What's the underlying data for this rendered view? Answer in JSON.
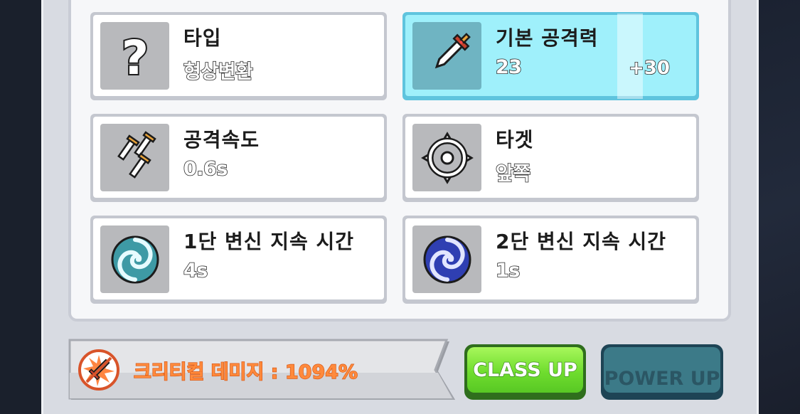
{
  "stats": [
    {
      "label": "타입",
      "value": "형상변환",
      "icon": "question-mark-icon"
    },
    {
      "label": "기본 공격력",
      "value": "23",
      "bonus": "+30",
      "icon": "sword-icon",
      "highlighted": true
    },
    {
      "label": "공격속도",
      "value": "0.6s",
      "icon": "triple-sword-icon"
    },
    {
      "label": "타겟",
      "value": "앞쪽",
      "icon": "crosshair-icon"
    },
    {
      "label": "1단 변신 지속 시간",
      "value": "4s",
      "icon": "teal-swirl-icon"
    },
    {
      "label": "2단 변신 지속 시간",
      "value": "1s",
      "icon": "blue-swirl-icon"
    }
  ],
  "critical": {
    "text": "크리티컬 데미지 : 1094%",
    "icon": "critical-sword-icon"
  },
  "buttons": {
    "class_up": "CLASS UP",
    "power_up": "POWER UP"
  },
  "colors": {
    "highlight_card": "#9ff0fb",
    "class_up_green": "#6fdd2e",
    "power_up_teal": "#3c7a88",
    "critical_orange": "#ff8a3c"
  }
}
